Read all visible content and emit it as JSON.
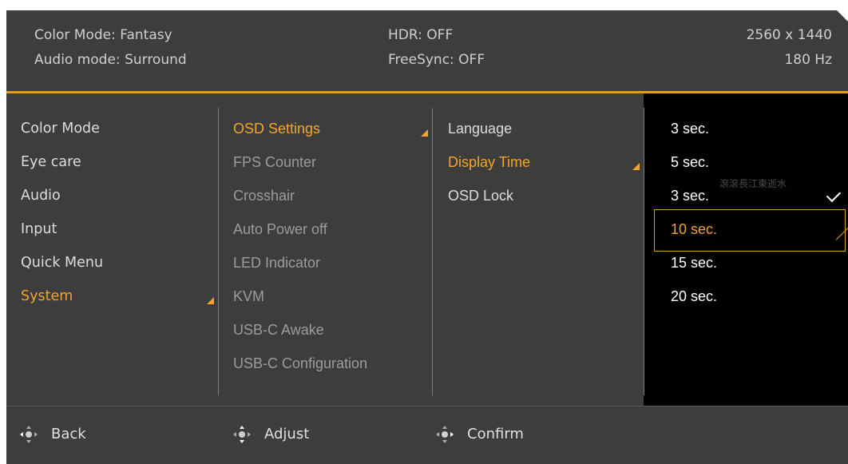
{
  "header": {
    "color_mode": "Color Mode: Fantasy",
    "audio_mode": "Audio mode: Surround",
    "hdr": "HDR: OFF",
    "freesync": "FreeSync: OFF",
    "resolution": "2560 x 1440",
    "refresh_rate": "180 Hz"
  },
  "main_menu": {
    "items": [
      {
        "label": "Color Mode"
      },
      {
        "label": "Eye care"
      },
      {
        "label": "Audio"
      },
      {
        "label": "Input"
      },
      {
        "label": "Quick Menu"
      },
      {
        "label": "System",
        "active": true
      }
    ]
  },
  "system_menu": {
    "items": [
      {
        "label": "OSD Settings",
        "active": true
      },
      {
        "label": "FPS Counter"
      },
      {
        "label": "Crosshair"
      },
      {
        "label": "Auto Power off"
      },
      {
        "label": "LED Indicator"
      },
      {
        "label": "KVM"
      },
      {
        "label": "USB-C Awake"
      },
      {
        "label": "USB-C Configuration"
      }
    ]
  },
  "osd_settings_menu": {
    "items": [
      {
        "label": "Language"
      },
      {
        "label": "Display Time",
        "active": true
      },
      {
        "label": "OSD Lock"
      }
    ]
  },
  "display_time_options": {
    "items": [
      {
        "label": "3 sec."
      },
      {
        "label": "5 sec."
      },
      {
        "label": "3 sec.",
        "checked": true
      },
      {
        "label": "10 sec.",
        "highlighted": true
      },
      {
        "label": "15 sec."
      },
      {
        "label": "20 sec."
      }
    ],
    "watermark": "滾滾長江東逝水"
  },
  "footer": {
    "back": "Back",
    "adjust": "Adjust",
    "confirm": "Confirm"
  },
  "colors": {
    "accent": "#f2a52d",
    "panel": "#3d3d3d",
    "options_panel": "#000000"
  },
  "icons": {
    "back": "joystick-left-icon",
    "adjust": "joystick-up-down-icon",
    "confirm": "joystick-right-icon",
    "selected": "checkmark-icon",
    "submenu": "submenu-arrow-icon"
  }
}
